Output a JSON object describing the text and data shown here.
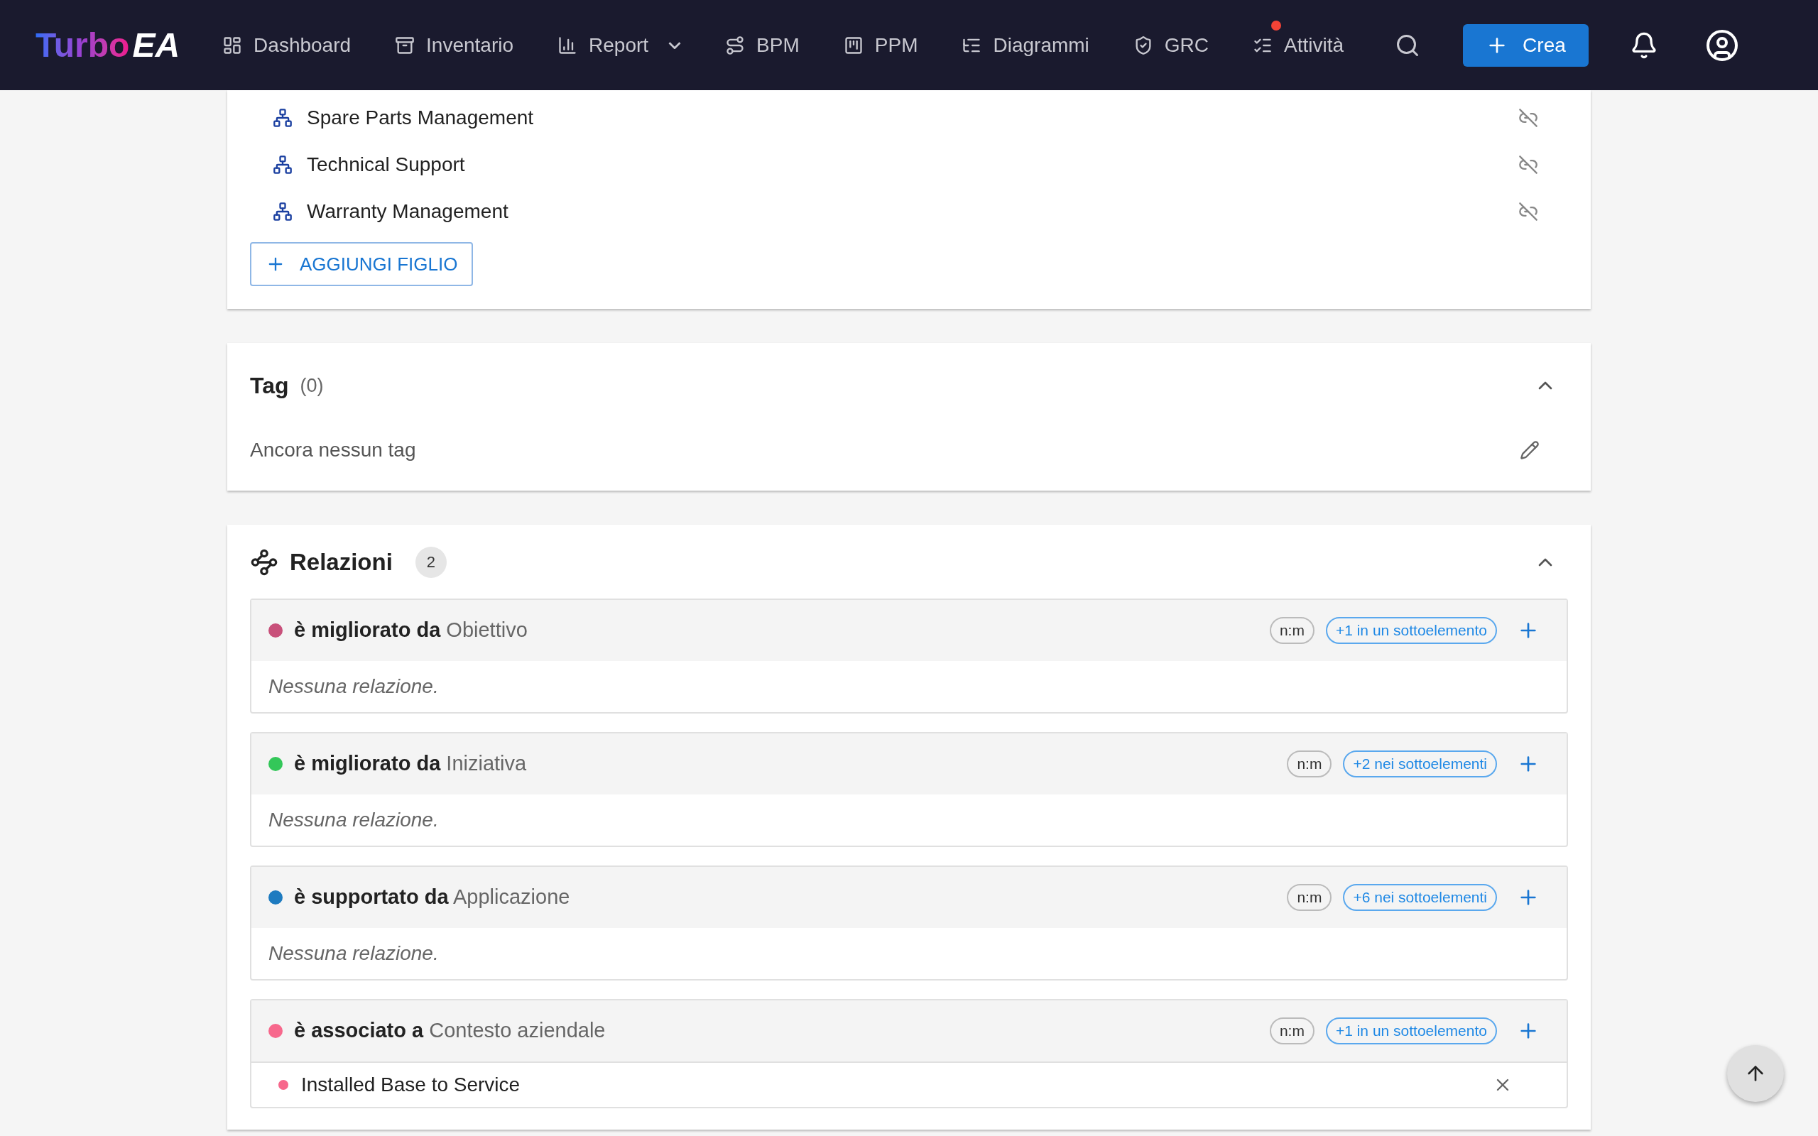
{
  "nav": {
    "logo": {
      "part1": "Turbo",
      "part2": "EA"
    },
    "items": [
      {
        "label": "Dashboard",
        "dropdown": false,
        "badge": false
      },
      {
        "label": "Inventario",
        "dropdown": false,
        "badge": false
      },
      {
        "label": "Report",
        "dropdown": true,
        "badge": false
      },
      {
        "label": "BPM",
        "dropdown": false,
        "badge": false
      },
      {
        "label": "PPM",
        "dropdown": false,
        "badge": false
      },
      {
        "label": "Diagrammi",
        "dropdown": false,
        "badge": false
      },
      {
        "label": "GRC",
        "dropdown": false,
        "badge": false
      },
      {
        "label": "Attività",
        "dropdown": false,
        "badge": true
      }
    ],
    "create_button": "Crea"
  },
  "children_list": {
    "items": [
      {
        "name": "Spare Parts Management"
      },
      {
        "name": "Technical Support"
      },
      {
        "name": "Warranty Management"
      }
    ],
    "add_button": "AGGIUNGI FIGLIO"
  },
  "tags": {
    "title": "Tag",
    "count": "(0)",
    "expanded": true,
    "empty_text": "Ancora nessun tag"
  },
  "relations": {
    "title": "Relazioni",
    "count": "2",
    "expanded": true,
    "groups": [
      {
        "verb": "è migliorato da",
        "target": "Obiettivo",
        "color": "#c8507a",
        "cardinality": "n:m",
        "sub_count": "+1 in un sottoelemento",
        "empty_text": "Nessuna relazione."
      },
      {
        "verb": "è migliorato da",
        "target": "Iniziativa",
        "color": "#33c759",
        "cardinality": "n:m",
        "sub_count": "+2 nei sottoelementi",
        "empty_text": "Nessuna relazione."
      },
      {
        "verb": "è supportato da",
        "target": "Applicazione",
        "color": "#1e7bc0",
        "cardinality": "n:m",
        "sub_count": "+6 nei sottoelementi",
        "empty_text": "Nessuna relazione."
      },
      {
        "verb": "è associato a",
        "target": "Contesto aziendale",
        "color": "#f7688c",
        "cardinality": "n:m",
        "sub_count": "+1 in un sottoelemento",
        "items": [
          {
            "name": "Installed Base to Service",
            "color": "#f7688c"
          }
        ]
      }
    ]
  }
}
